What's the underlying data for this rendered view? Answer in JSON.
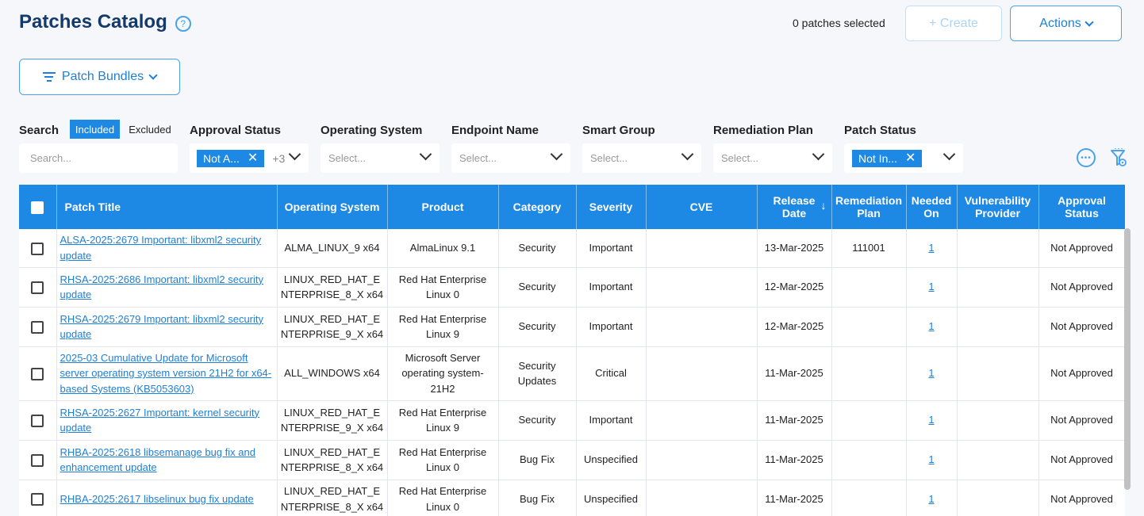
{
  "header": {
    "title": "Patches Catalog",
    "help_icon": "?",
    "selected_text": "0 patches selected",
    "create_label": "+ Create",
    "actions_label": "Actions"
  },
  "bundles_label": "Patch Bundles",
  "filters": {
    "search_label": "Search",
    "included_label": "Included",
    "excluded_label": "Excluded",
    "search_placeholder": "Search...",
    "approval_label": "Approval Status",
    "approval_chip": "Not A...",
    "approval_more": "+3",
    "os_label": "Operating System",
    "os_placeholder": "Select...",
    "endpoint_label": "Endpoint Name",
    "endpoint_placeholder": "Select...",
    "smartgroup_label": "Smart Group",
    "smartgroup_placeholder": "Select...",
    "remediation_label": "Remediation Plan",
    "remediation_placeholder": "Select...",
    "patchstatus_label": "Patch Status",
    "patchstatus_chip": "Not In..."
  },
  "columns": [
    "Patch Title",
    "Operating System",
    "Product",
    "Category",
    "Severity",
    "CVE",
    "Release Date",
    "Remediation Plan",
    "Needed On",
    "Vulnerability Provider",
    "Approval Status"
  ],
  "sort_arrow": "↓",
  "rows": [
    {
      "title": "ALSA-2025:2679 Important: libxml2 security update",
      "os": "ALMA_LINUX_9 x64",
      "product": "AlmaLinux 9.1",
      "category": "Security",
      "severity": "Important",
      "cve": "",
      "release": "13-Mar-2025",
      "remediation": "111001",
      "needed": "1",
      "provider": "",
      "approval": "Not Approved"
    },
    {
      "title": "RHSA-2025:2686 Important: libxml2 security update",
      "os": "LINUX_RED_HAT_ENTERPRISE_8_X x64",
      "product": "Red Hat Enterprise Linux 0",
      "category": "Security",
      "severity": "Important",
      "cve": "",
      "release": "12-Mar-2025",
      "remediation": "",
      "needed": "1",
      "provider": "",
      "approval": "Not Approved"
    },
    {
      "title": "RHSA-2025:2679 Important: libxml2 security update",
      "os": "LINUX_RED_HAT_ENTERPRISE_9_X x64",
      "product": "Red Hat Enterprise Linux 9",
      "category": "Security",
      "severity": "Important",
      "cve": "",
      "release": "12-Mar-2025",
      "remediation": "",
      "needed": "1",
      "provider": "",
      "approval": "Not Approved"
    },
    {
      "title": "2025-03 Cumulative Update for Microsoft server operating system version 21H2 for x64-based Systems (KB5053603)",
      "os": "ALL_WINDOWS x64",
      "product": "Microsoft Server operating system-21H2",
      "category": "Security Updates",
      "severity": "Critical",
      "cve": "",
      "release": "11-Mar-2025",
      "remediation": "",
      "needed": "1",
      "provider": "",
      "approval": "Not Approved"
    },
    {
      "title": "RHSA-2025:2627 Important: kernel security update",
      "os": "LINUX_RED_HAT_ENTERPRISE_9_X x64",
      "product": "Red Hat Enterprise Linux 9",
      "category": "Security",
      "severity": "Important",
      "cve": "",
      "release": "11-Mar-2025",
      "remediation": "",
      "needed": "1",
      "provider": "",
      "approval": "Not Approved"
    },
    {
      "title": "RHBA-2025:2618 libsemanage bug fix and enhancement update",
      "os": "LINUX_RED_HAT_ENTERPRISE_8_X x64",
      "product": "Red Hat Enterprise Linux 0",
      "category": "Bug Fix",
      "severity": "Unspecified",
      "cve": "",
      "release": "11-Mar-2025",
      "remediation": "",
      "needed": "1",
      "provider": "",
      "approval": "Not Approved"
    },
    {
      "title": "RHBA-2025:2617 libselinux bug fix update",
      "os": "LINUX_RED_HAT_ENTERPRISE_8_X x64",
      "product": "Red Hat Enterprise Linux 0",
      "category": "Bug Fix",
      "severity": "Unspecified",
      "cve": "",
      "release": "11-Mar-2025",
      "remediation": "",
      "needed": "1",
      "provider": "",
      "approval": "Not Approved"
    }
  ]
}
